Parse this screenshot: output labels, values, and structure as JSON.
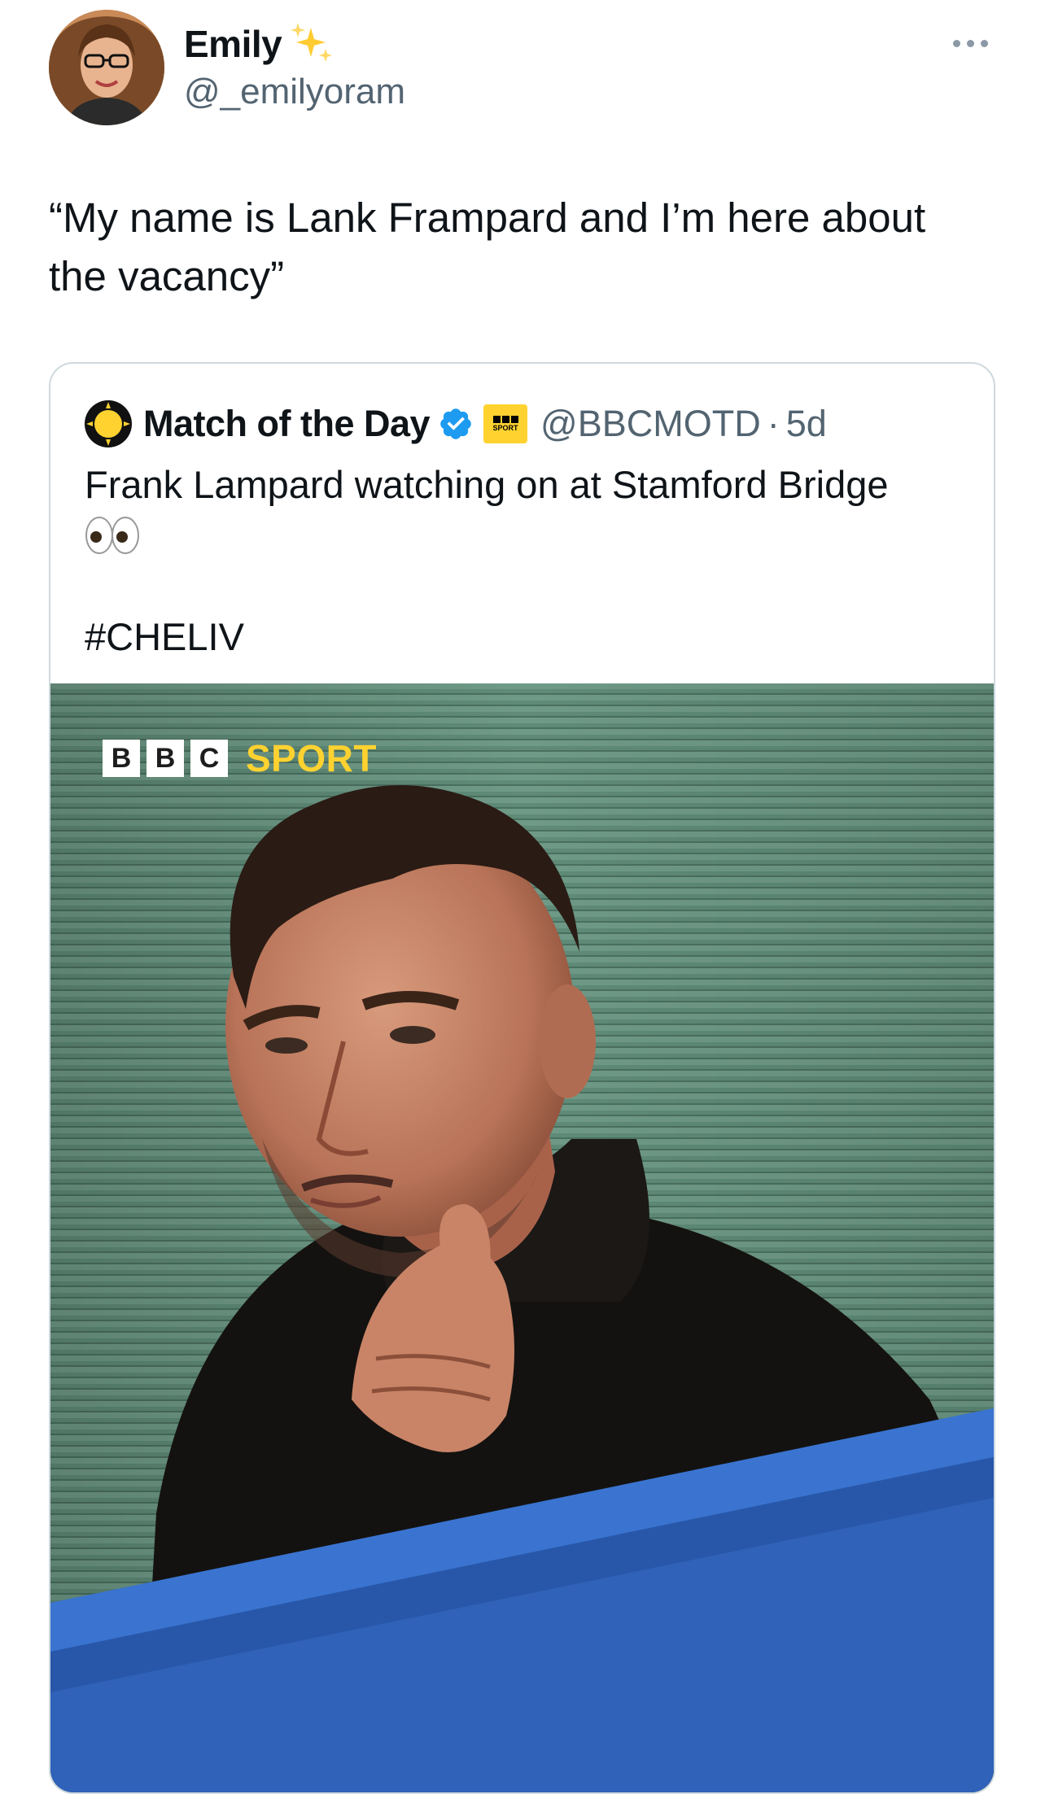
{
  "author": {
    "name": "Emily",
    "handle": "@_emilyoram",
    "name_emoji_icon": "sparkles-icon"
  },
  "tweet": {
    "text": "“My name is Lank Frampard and I’m here about the vacancy”"
  },
  "quoted_tweet": {
    "name": "Match of the Day",
    "handle": "@BBCMOTD",
    "separator": "·",
    "time": "5d",
    "text": "Frank Lampard watching on at Stamford Bridge",
    "emoji_icon": "eyes-icon",
    "hashtag": "#CHELIV",
    "verified_color": "#1d9bf0",
    "affiliate_badge": "BBC SPORT",
    "media": {
      "logo_letters": [
        "B",
        "B",
        "C"
      ],
      "logo_sport": "SPORT",
      "logo_sport_color": "#ffd230",
      "stand_color": "#2f62b8"
    }
  }
}
